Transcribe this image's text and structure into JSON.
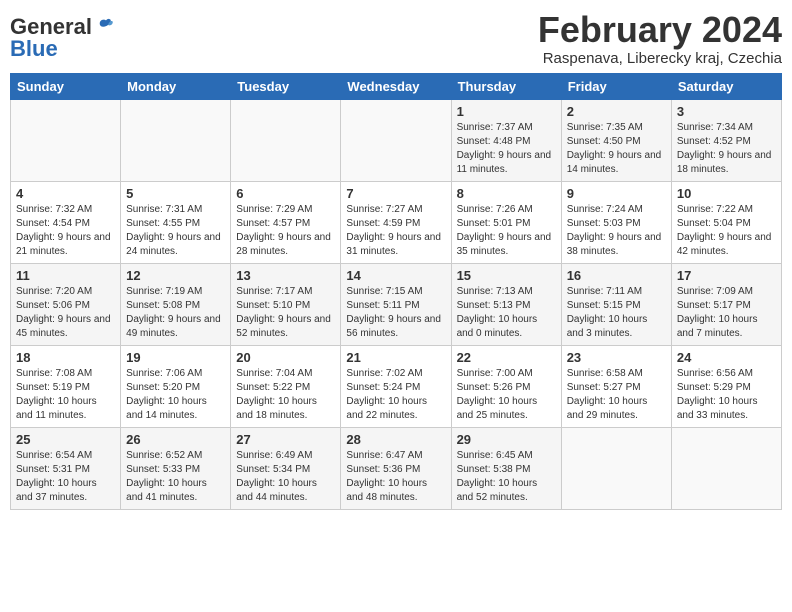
{
  "header": {
    "logo_general": "General",
    "logo_blue": "Blue",
    "month": "February 2024",
    "location": "Raspenava, Liberecky kraj, Czechia"
  },
  "days_of_week": [
    "Sunday",
    "Monday",
    "Tuesday",
    "Wednesday",
    "Thursday",
    "Friday",
    "Saturday"
  ],
  "weeks": [
    [
      {
        "day": "",
        "info": ""
      },
      {
        "day": "",
        "info": ""
      },
      {
        "day": "",
        "info": ""
      },
      {
        "day": "",
        "info": ""
      },
      {
        "day": "1",
        "info": "Sunrise: 7:37 AM\nSunset: 4:48 PM\nDaylight: 9 hours\nand 11 minutes."
      },
      {
        "day": "2",
        "info": "Sunrise: 7:35 AM\nSunset: 4:50 PM\nDaylight: 9 hours\nand 14 minutes."
      },
      {
        "day": "3",
        "info": "Sunrise: 7:34 AM\nSunset: 4:52 PM\nDaylight: 9 hours\nand 18 minutes."
      }
    ],
    [
      {
        "day": "4",
        "info": "Sunrise: 7:32 AM\nSunset: 4:54 PM\nDaylight: 9 hours\nand 21 minutes."
      },
      {
        "day": "5",
        "info": "Sunrise: 7:31 AM\nSunset: 4:55 PM\nDaylight: 9 hours\nand 24 minutes."
      },
      {
        "day": "6",
        "info": "Sunrise: 7:29 AM\nSunset: 4:57 PM\nDaylight: 9 hours\nand 28 minutes."
      },
      {
        "day": "7",
        "info": "Sunrise: 7:27 AM\nSunset: 4:59 PM\nDaylight: 9 hours\nand 31 minutes."
      },
      {
        "day": "8",
        "info": "Sunrise: 7:26 AM\nSunset: 5:01 PM\nDaylight: 9 hours\nand 35 minutes."
      },
      {
        "day": "9",
        "info": "Sunrise: 7:24 AM\nSunset: 5:03 PM\nDaylight: 9 hours\nand 38 minutes."
      },
      {
        "day": "10",
        "info": "Sunrise: 7:22 AM\nSunset: 5:04 PM\nDaylight: 9 hours\nand 42 minutes."
      }
    ],
    [
      {
        "day": "11",
        "info": "Sunrise: 7:20 AM\nSunset: 5:06 PM\nDaylight: 9 hours\nand 45 minutes."
      },
      {
        "day": "12",
        "info": "Sunrise: 7:19 AM\nSunset: 5:08 PM\nDaylight: 9 hours\nand 49 minutes."
      },
      {
        "day": "13",
        "info": "Sunrise: 7:17 AM\nSunset: 5:10 PM\nDaylight: 9 hours\nand 52 minutes."
      },
      {
        "day": "14",
        "info": "Sunrise: 7:15 AM\nSunset: 5:11 PM\nDaylight: 9 hours\nand 56 minutes."
      },
      {
        "day": "15",
        "info": "Sunrise: 7:13 AM\nSunset: 5:13 PM\nDaylight: 10 hours\nand 0 minutes."
      },
      {
        "day": "16",
        "info": "Sunrise: 7:11 AM\nSunset: 5:15 PM\nDaylight: 10 hours\nand 3 minutes."
      },
      {
        "day": "17",
        "info": "Sunrise: 7:09 AM\nSunset: 5:17 PM\nDaylight: 10 hours\nand 7 minutes."
      }
    ],
    [
      {
        "day": "18",
        "info": "Sunrise: 7:08 AM\nSunset: 5:19 PM\nDaylight: 10 hours\nand 11 minutes."
      },
      {
        "day": "19",
        "info": "Sunrise: 7:06 AM\nSunset: 5:20 PM\nDaylight: 10 hours\nand 14 minutes."
      },
      {
        "day": "20",
        "info": "Sunrise: 7:04 AM\nSunset: 5:22 PM\nDaylight: 10 hours\nand 18 minutes."
      },
      {
        "day": "21",
        "info": "Sunrise: 7:02 AM\nSunset: 5:24 PM\nDaylight: 10 hours\nand 22 minutes."
      },
      {
        "day": "22",
        "info": "Sunrise: 7:00 AM\nSunset: 5:26 PM\nDaylight: 10 hours\nand 25 minutes."
      },
      {
        "day": "23",
        "info": "Sunrise: 6:58 AM\nSunset: 5:27 PM\nDaylight: 10 hours\nand 29 minutes."
      },
      {
        "day": "24",
        "info": "Sunrise: 6:56 AM\nSunset: 5:29 PM\nDaylight: 10 hours\nand 33 minutes."
      }
    ],
    [
      {
        "day": "25",
        "info": "Sunrise: 6:54 AM\nSunset: 5:31 PM\nDaylight: 10 hours\nand 37 minutes."
      },
      {
        "day": "26",
        "info": "Sunrise: 6:52 AM\nSunset: 5:33 PM\nDaylight: 10 hours\nand 41 minutes."
      },
      {
        "day": "27",
        "info": "Sunrise: 6:49 AM\nSunset: 5:34 PM\nDaylight: 10 hours\nand 44 minutes."
      },
      {
        "day": "28",
        "info": "Sunrise: 6:47 AM\nSunset: 5:36 PM\nDaylight: 10 hours\nand 48 minutes."
      },
      {
        "day": "29",
        "info": "Sunrise: 6:45 AM\nSunset: 5:38 PM\nDaylight: 10 hours\nand 52 minutes."
      },
      {
        "day": "",
        "info": ""
      },
      {
        "day": "",
        "info": ""
      }
    ]
  ]
}
